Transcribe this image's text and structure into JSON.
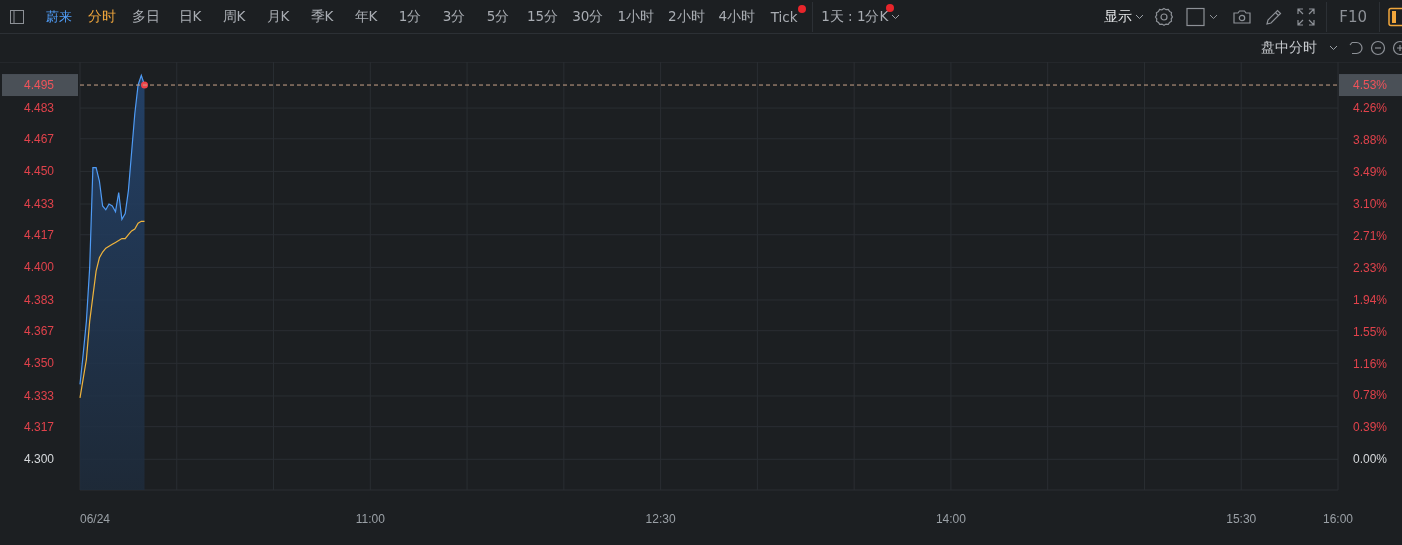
{
  "toolbar": {
    "symbol": "蔚来",
    "periods": [
      {
        "label": "分时",
        "selected": true,
        "dot": false
      },
      {
        "label": "多日",
        "selected": false,
        "dot": false
      },
      {
        "label": "日K",
        "selected": false,
        "dot": false
      },
      {
        "label": "周K",
        "selected": false,
        "dot": false
      },
      {
        "label": "月K",
        "selected": false,
        "dot": false
      },
      {
        "label": "季K",
        "selected": false,
        "dot": false
      },
      {
        "label": "年K",
        "selected": false,
        "dot": false
      },
      {
        "label": "1分",
        "selected": false,
        "dot": false
      },
      {
        "label": "3分",
        "selected": false,
        "dot": false
      },
      {
        "label": "5分",
        "selected": false,
        "dot": false
      },
      {
        "label": "15分",
        "selected": false,
        "dot": false
      },
      {
        "label": "30分",
        "selected": false,
        "dot": false
      },
      {
        "label": "1小时",
        "selected": false,
        "dot": false
      },
      {
        "label": "2小时",
        "selected": false,
        "dot": false
      },
      {
        "label": "4小时",
        "selected": false,
        "dot": false
      },
      {
        "label": "Tick",
        "selected": false,
        "dot": true
      }
    ],
    "range_dropdown": {
      "label": "1天 : 1分K",
      "dot": true
    },
    "display_dropdown": "显示",
    "f10": "F10"
  },
  "subbar": {
    "mode_dropdown": "盘中分时"
  },
  "chart": {
    "current_price": "4.495",
    "current_change": "4.53%",
    "right_axis": [
      {
        "label": "4.26%",
        "kind": "up"
      },
      {
        "label": "3.88%",
        "kind": "up"
      },
      {
        "label": "3.49%",
        "kind": "up"
      },
      {
        "label": "3.10%",
        "kind": "up"
      },
      {
        "label": "2.71%",
        "kind": "up"
      },
      {
        "label": "2.33%",
        "kind": "up"
      },
      {
        "label": "1.94%",
        "kind": "up"
      },
      {
        "label": "1.55%",
        "kind": "up"
      },
      {
        "label": "1.16%",
        "kind": "up"
      },
      {
        "label": "0.78%",
        "kind": "up"
      },
      {
        "label": "0.39%",
        "kind": "up"
      },
      {
        "label": "0.00%",
        "kind": "flat"
      }
    ],
    "chart_data": {
      "type": "area",
      "grid": true,
      "x": [
        9.5,
        9.5167,
        9.5333,
        9.55,
        9.5667,
        9.5833,
        9.6,
        9.6167,
        9.6333,
        9.65,
        9.6667,
        9.6833,
        9.7,
        9.7167,
        9.7333,
        9.75,
        9.7667,
        9.7833,
        9.8,
        9.8167,
        9.8333
      ],
      "series": [
        {
          "type": "area",
          "color": "#4f9bf5",
          "values": [
            4.339,
            4.355,
            4.372,
            4.4,
            4.452,
            4.452,
            4.445,
            4.432,
            4.43,
            4.433,
            4.432,
            4.429,
            4.439,
            4.425,
            4.428,
            4.44,
            4.46,
            4.48,
            4.495,
            4.5,
            4.495
          ]
        },
        {
          "type": "line",
          "color": "#f0b43c",
          "values": [
            4.332,
            4.342,
            4.352,
            4.372,
            4.385,
            4.398,
            4.405,
            4.408,
            4.41,
            4.411,
            4.412,
            4.413,
            4.414,
            4.415,
            4.415,
            4.417,
            4.419,
            4.42,
            4.423,
            4.424,
            4.424
          ]
        }
      ],
      "xlim": [
        9.5,
        16
      ],
      "ylim": [
        4.284,
        4.507
      ],
      "xticks": [
        {
          "value": 9.5,
          "label": "06/24"
        },
        {
          "value": 11,
          "label": "11:00"
        },
        {
          "value": 12.5,
          "label": "12:30"
        },
        {
          "value": 14,
          "label": "14:00"
        },
        {
          "value": 15.5,
          "label": "15:30"
        },
        {
          "value": 16,
          "label": "16:00"
        }
      ],
      "yticks": [
        {
          "value": 4.483,
          "label": "4.483"
        },
        {
          "value": 4.467,
          "label": "4.467"
        },
        {
          "value": 4.45,
          "label": "4.450"
        },
        {
          "value": 4.433,
          "label": "4.433"
        },
        {
          "value": 4.417,
          "label": "4.417"
        },
        {
          "value": 4.4,
          "label": "4.400"
        },
        {
          "value": 4.383,
          "label": "4.383"
        },
        {
          "value": 4.367,
          "label": "4.367"
        },
        {
          "value": 4.35,
          "label": "4.350"
        },
        {
          "value": 4.333,
          "label": "4.333"
        },
        {
          "value": 4.317,
          "label": "4.317"
        },
        {
          "value": 4.3,
          "label": "4.300"
        }
      ]
    }
  }
}
